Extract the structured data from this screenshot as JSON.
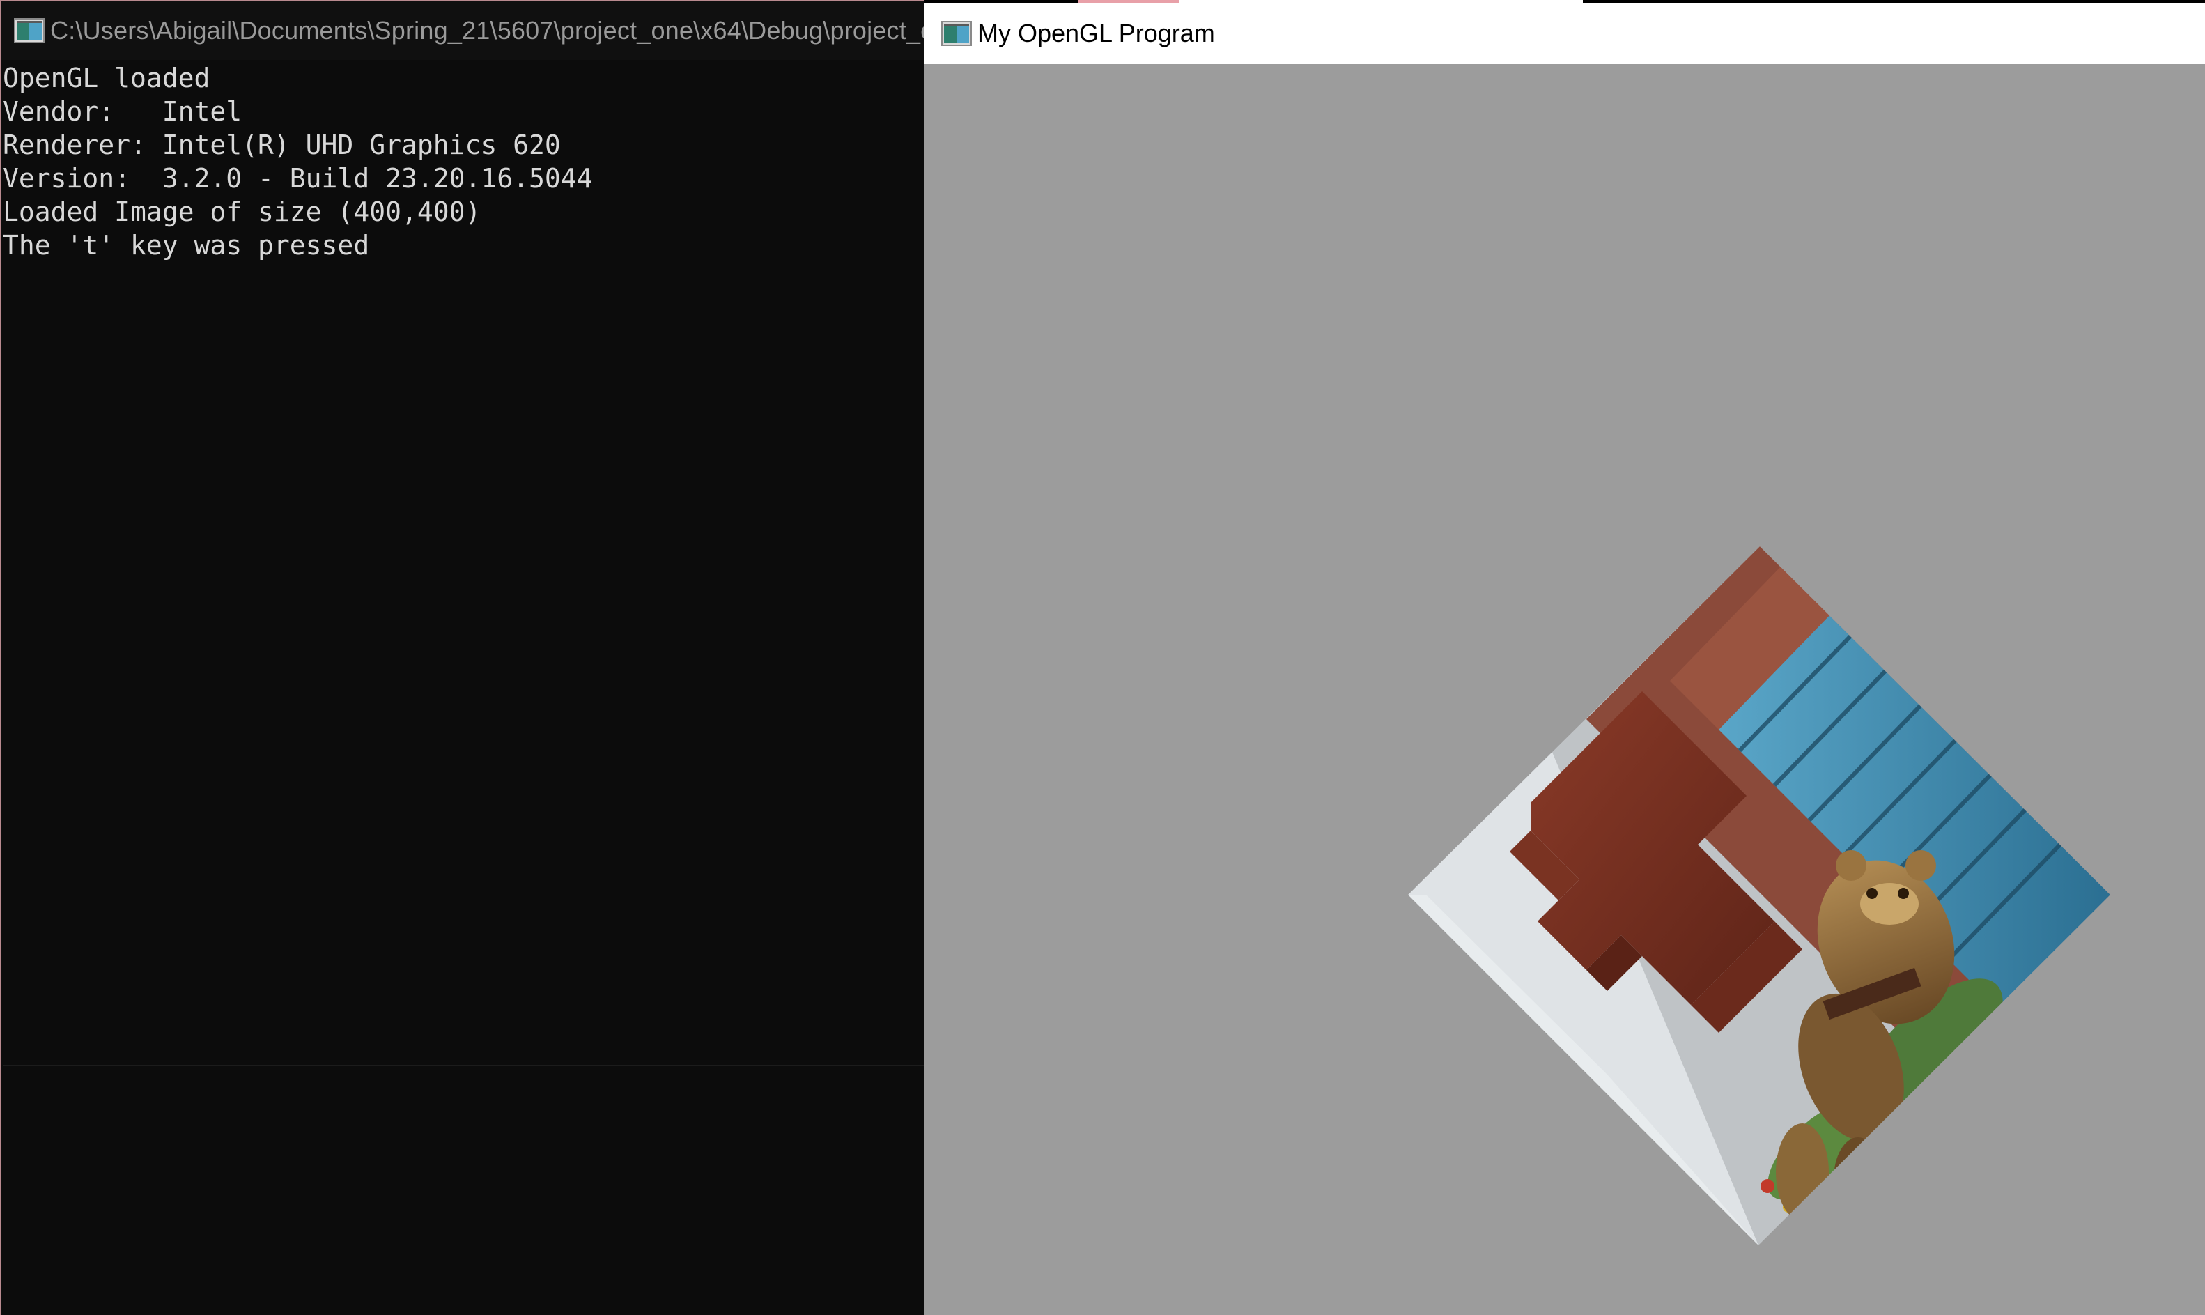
{
  "console_window": {
    "title": "C:\\Users\\Abigail\\Documents\\Spring_21\\5607\\project_one\\x64\\Debug\\project_c",
    "icon": "console-app-icon",
    "lines": [
      "OpenGL loaded",
      "Vendor:   Intel",
      "Renderer: Intel(R) UHD Graphics 620",
      "Version:  3.2.0 - Build 23.20.16.5044",
      "Loaded Image of size (400,400)",
      "The 't' key was pressed"
    ],
    "background_color": "#0c0c0c",
    "text_color": "#d8d8d8"
  },
  "gl_window": {
    "title": "My OpenGL Program",
    "icon": "opengl-app-icon",
    "clear_color": "#9c9c9c",
    "rendered_content": "rotated-textured-quad-photo"
  }
}
